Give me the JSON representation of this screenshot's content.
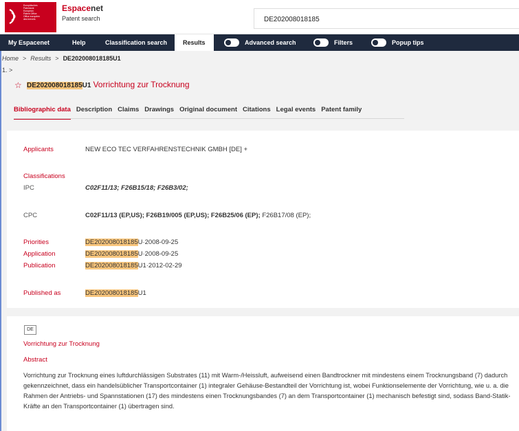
{
  "header": {
    "logo_lines": [
      "Europäisches",
      "Patentamt",
      "European",
      "Patent Office",
      "Office européen",
      "des brevets"
    ],
    "brand_name_a": "Espace",
    "brand_name_b": "net",
    "brand_subtitle": "Patent search",
    "search_value": "DE202008018185"
  },
  "nav": {
    "my_espacenet": "My Espacenet",
    "help": "Help",
    "classification_search": "Classification search",
    "results": "Results",
    "advanced_search": "Advanced search",
    "filters": "Filters",
    "popup_tips": "Popup tips"
  },
  "breadcrumb": {
    "home": "Home",
    "results": "Results",
    "current": "DE202008018185U1"
  },
  "row_number": "1.",
  "document": {
    "number": "DE202008018185",
    "kind": "U1",
    "title": "Vorrichtung zur Trocknung"
  },
  "tabs": [
    "Bibliographic data",
    "Description",
    "Claims",
    "Drawings",
    "Original document",
    "Citations",
    "Legal events",
    "Patent family"
  ],
  "biblio": {
    "applicants_label": "Applicants",
    "applicants_value": "NEW ECO TEC VERFAHRENSTECHNIK GMBH [DE]",
    "applicants_more": "+",
    "classifications_label": "Classifications",
    "ipc_label": "IPC",
    "ipc_value": "C02F11/13; F26B15/18; F26B3/02;",
    "cpc_label": "CPC",
    "cpc_bold": "C02F11/13 (EP,US); F26B19/005 (EP,US); F26B25/06 (EP);",
    "cpc_plain": "F26B17/08 (EP);",
    "priorities_label": "Priorities",
    "priorities_num": "DE202008018185",
    "priorities_rest": "U·2008-09-25",
    "application_label": "Application",
    "application_num": "DE202008018185",
    "application_rest": "U·2008-09-25",
    "publication_label": "Publication",
    "publication_num": "DE202008018185",
    "publication_rest": "U1·2012-02-29",
    "published_as_label": "Published as",
    "published_as_num": "DE202008018185",
    "published_as_rest": "U1"
  },
  "abstract": {
    "lang": "DE",
    "title": "Vorrichtung zur Trocknung",
    "heading": "Abstract",
    "text": "Vorrichtung zur Trocknung eines luftdurchlässigen Substrates (11) mit Warm-/Heissluft, aufweisend einen Bandtrockner mit mindestens einem Trocknungsband (7) dadurch gekennzeichnet, dass ein handelsüblicher Transportcontainer (1) integraler Gehäuse-Bestandteil der Vorrichtung ist, wobei Funktionselemente der Vorrichtung, wie u. a. die Rahmen der Antriebs- und Spannstationen (17) des mindestens einen Trocknungsbandes (7) an dem Transportcontainer (1) mechanisch befestigt sind, sodass Band-Statik-Kräfte an den Transportcontainer (1) übertragen sind."
  },
  "colors": {
    "brand_red": "#c8001e",
    "nav_bg": "#1f2a3e",
    "highlight": "#f8c57c"
  }
}
